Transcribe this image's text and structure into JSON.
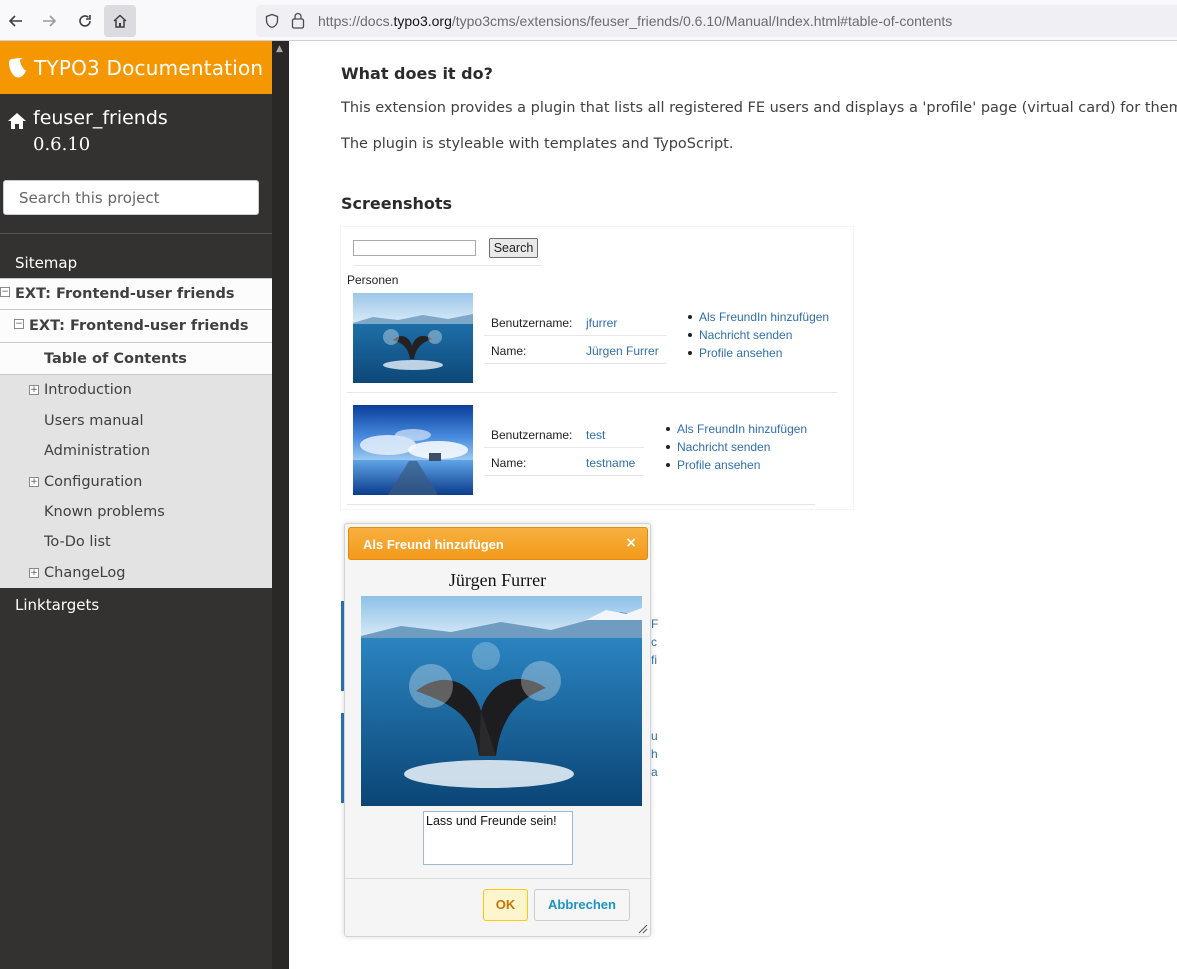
{
  "browser": {
    "url_prefix": "https://docs.",
    "url_domain": "typo3.org",
    "url_path": "/typo3cms/extensions/feuser_friends/0.6.10/Manual/Index.html#table-of-contents"
  },
  "sidebar": {
    "brand": "TYPO3 Documentation",
    "project_name": "feuser_friends",
    "project_version": "0.6.10",
    "search_placeholder": "Search this project",
    "sitemap": "Sitemap",
    "ext_l1": "EXT: Frontend-user friends",
    "ext_l2": "EXT: Frontend-user friends",
    "current": "Table of Contents",
    "items": [
      {
        "label": "Introduction"
      },
      {
        "label": "Users manual"
      },
      {
        "label": "Administration"
      },
      {
        "label": "Configuration"
      },
      {
        "label": "Known problems"
      },
      {
        "label": "To-Do list"
      },
      {
        "label": "ChangeLog"
      }
    ],
    "linktargets": "Linktargets"
  },
  "main": {
    "heading_what": "What does it do?",
    "para1": "This extension provides a plugin that lists all registered FE users and displays a 'profile' page (virtual card) for them.",
    "para2": "The plugin is styleable with templates and TypoScript.",
    "heading_shots": "Screenshots"
  },
  "screenshot": {
    "search_button": "Search",
    "personen": "Personen",
    "users": [
      {
        "user_label": "Benutzername:",
        "user_value": "jfurrer",
        "name_label": "Name:",
        "name_value": "Jürgen Furrer",
        "actions": [
          "Als FreundIn hinzufügen",
          "Nachricht senden",
          "Profile ansehen"
        ]
      },
      {
        "user_label": "Benutzername:",
        "user_value": "test",
        "name_label": "Name:",
        "name_value": "testname",
        "actions": [
          "Als FreundIn hinzufügen",
          "Nachricht senden",
          "Profile ansehen"
        ]
      }
    ]
  },
  "dialog": {
    "title": "Als Freund hinzufügen",
    "close_icon": "×",
    "person": "Jürgen Furrer",
    "message": "Lass und Freunde sein!",
    "ok": "OK",
    "cancel": "Abbrechen"
  },
  "colors": {
    "brand_orange": "#f49700",
    "sidebar_bg": "#343131",
    "link_blue": "#2e6fae"
  }
}
